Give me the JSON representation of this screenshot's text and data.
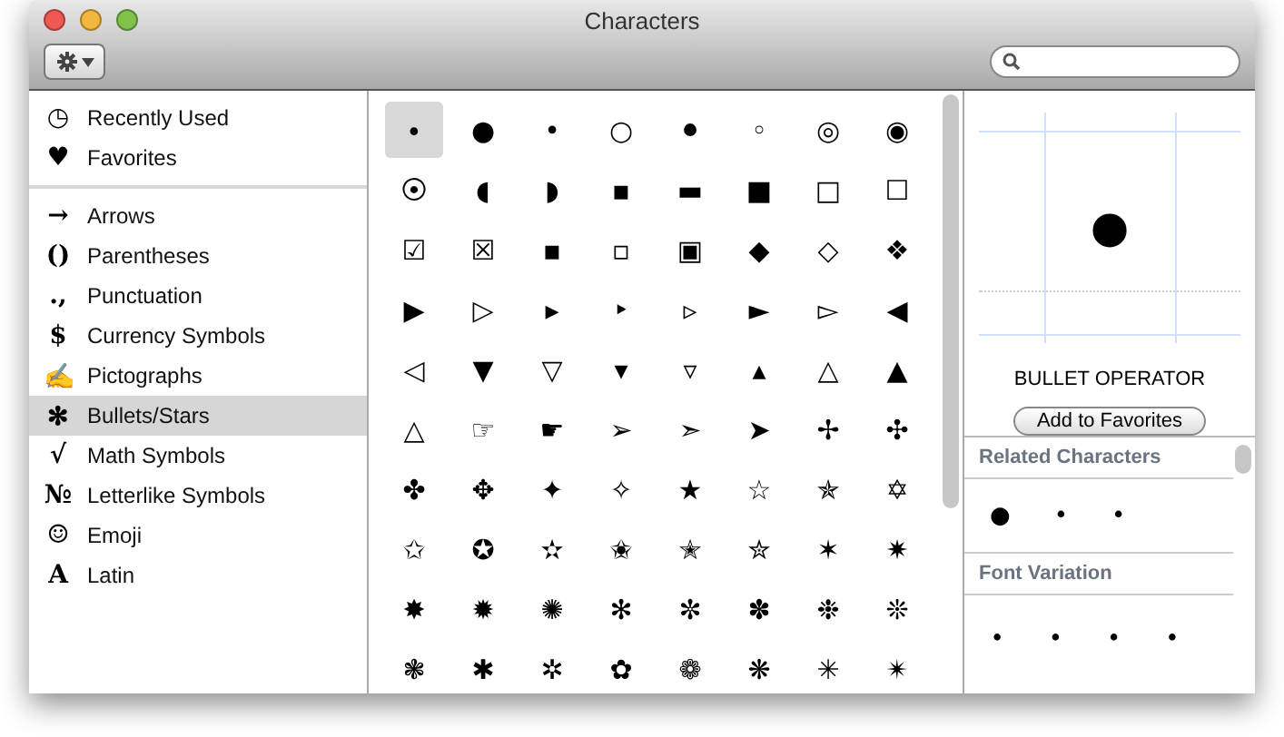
{
  "window": {
    "title": "Characters"
  },
  "sidebar": {
    "groups": [
      {
        "items": [
          {
            "glyph": "◷",
            "label": "Recently Used",
            "selected": false
          },
          {
            "glyph": "♥",
            "label": "Favorites",
            "selected": false
          }
        ]
      },
      {
        "items": [
          {
            "glyph": "→",
            "label": "Arrows",
            "selected": false
          },
          {
            "glyph": "()",
            "label": "Parentheses",
            "selected": false
          },
          {
            "glyph": ".,",
            "label": "Punctuation",
            "selected": false
          },
          {
            "glyph": "$",
            "label": "Currency Symbols",
            "selected": false
          },
          {
            "glyph": "✍",
            "label": "Pictographs",
            "selected": false
          },
          {
            "glyph": "✻",
            "label": "Bullets/Stars",
            "selected": true
          },
          {
            "glyph": "√",
            "label": "Math Symbols",
            "selected": false
          },
          {
            "glyph": "№",
            "label": "Letterlike Symbols",
            "selected": false
          },
          {
            "glyph": "☺",
            "label": "Emoji",
            "selected": false
          },
          {
            "glyph": "A",
            "label": "Latin",
            "selected": false
          }
        ]
      }
    ]
  },
  "grid": {
    "rows": [
      [
        {
          "char": "∙",
          "selected": true
        },
        {
          "char": "●",
          "selected": false
        },
        {
          "char": "•",
          "selected": false
        },
        {
          "char": "○",
          "selected": false
        },
        {
          "char": "⚫",
          "selected": false
        },
        {
          "char": "◦",
          "selected": false
        },
        {
          "char": "◎",
          "selected": false
        },
        {
          "char": "◉",
          "selected": false
        }
      ],
      [
        {
          "char": "⦿",
          "selected": false
        },
        {
          "char": "◖",
          "selected": false
        },
        {
          "char": "◗",
          "selected": false
        },
        {
          "char": "▪",
          "selected": false
        },
        {
          "char": "▬",
          "selected": false
        },
        {
          "char": "■",
          "selected": false
        },
        {
          "char": "□",
          "selected": false
        },
        {
          "char": "☐",
          "selected": false
        }
      ],
      [
        {
          "char": "☑",
          "selected": false
        },
        {
          "char": "☒",
          "selected": false
        },
        {
          "char": "▪",
          "selected": false
        },
        {
          "char": "▫",
          "selected": false
        },
        {
          "char": "▣",
          "selected": false
        },
        {
          "char": "◆",
          "selected": false
        },
        {
          "char": "◇",
          "selected": false
        },
        {
          "char": "❖",
          "selected": false
        }
      ],
      [
        {
          "char": "▶",
          "selected": false
        },
        {
          "char": "▷",
          "selected": false
        },
        {
          "char": "▸",
          "selected": false
        },
        {
          "char": "‣",
          "selected": false
        },
        {
          "char": "▹",
          "selected": false
        },
        {
          "char": "►",
          "selected": false
        },
        {
          "char": "▻",
          "selected": false
        },
        {
          "char": "◀",
          "selected": false
        }
      ],
      [
        {
          "char": "◁",
          "selected": false
        },
        {
          "char": "▼",
          "selected": false
        },
        {
          "char": "▽",
          "selected": false
        },
        {
          "char": "▾",
          "selected": false
        },
        {
          "char": "▿",
          "selected": false
        },
        {
          "char": "▴",
          "selected": false
        },
        {
          "char": "△",
          "selected": false
        },
        {
          "char": "▲",
          "selected": false
        }
      ],
      [
        {
          "char": "△",
          "selected": false
        },
        {
          "char": "☞",
          "selected": false
        },
        {
          "char": "☛",
          "selected": false
        },
        {
          "char": "➢",
          "selected": false
        },
        {
          "char": "➣",
          "selected": false
        },
        {
          "char": "➤",
          "selected": false
        },
        {
          "char": "✢",
          "selected": false
        },
        {
          "char": "✣",
          "selected": false
        }
      ],
      [
        {
          "char": "✤",
          "selected": false
        },
        {
          "char": "✥",
          "selected": false
        },
        {
          "char": "✦",
          "selected": false
        },
        {
          "char": "✧",
          "selected": false
        },
        {
          "char": "★",
          "selected": false
        },
        {
          "char": "☆",
          "selected": false
        },
        {
          "char": "✯",
          "selected": false
        },
        {
          "char": "✡",
          "selected": false
        }
      ],
      [
        {
          "char": "✩",
          "selected": false
        },
        {
          "char": "✪",
          "selected": false
        },
        {
          "char": "✫",
          "selected": false
        },
        {
          "char": "✬",
          "selected": false
        },
        {
          "char": "✭",
          "selected": false
        },
        {
          "char": "✮",
          "selected": false
        },
        {
          "char": "✶",
          "selected": false
        },
        {
          "char": "✷",
          "selected": false
        }
      ],
      [
        {
          "char": "✸",
          "selected": false
        },
        {
          "char": "✹",
          "selected": false
        },
        {
          "char": "✺",
          "selected": false
        },
        {
          "char": "✻",
          "selected": false
        },
        {
          "char": "✼",
          "selected": false
        },
        {
          "char": "✽",
          "selected": false
        },
        {
          "char": "❉",
          "selected": false
        },
        {
          "char": "❊",
          "selected": false
        }
      ],
      [
        {
          "char": "❃",
          "selected": false
        },
        {
          "char": "✱",
          "selected": false
        },
        {
          "char": "✲",
          "selected": false
        },
        {
          "char": "✿",
          "selected": false
        },
        {
          "char": "❁",
          "selected": false
        },
        {
          "char": "❋",
          "selected": false
        },
        {
          "char": "✳",
          "selected": false
        },
        {
          "char": "✴",
          "selected": false
        }
      ]
    ]
  },
  "detail": {
    "preview": "∙",
    "name": "BULLET OPERATOR",
    "button": "Add to Favorites",
    "sections": [
      {
        "title": "Related Characters",
        "chars": [
          "●",
          "•",
          "•"
        ]
      },
      {
        "title": "Font Variation",
        "chars": [
          "∙",
          "∙",
          "∙",
          "∙"
        ]
      }
    ]
  }
}
